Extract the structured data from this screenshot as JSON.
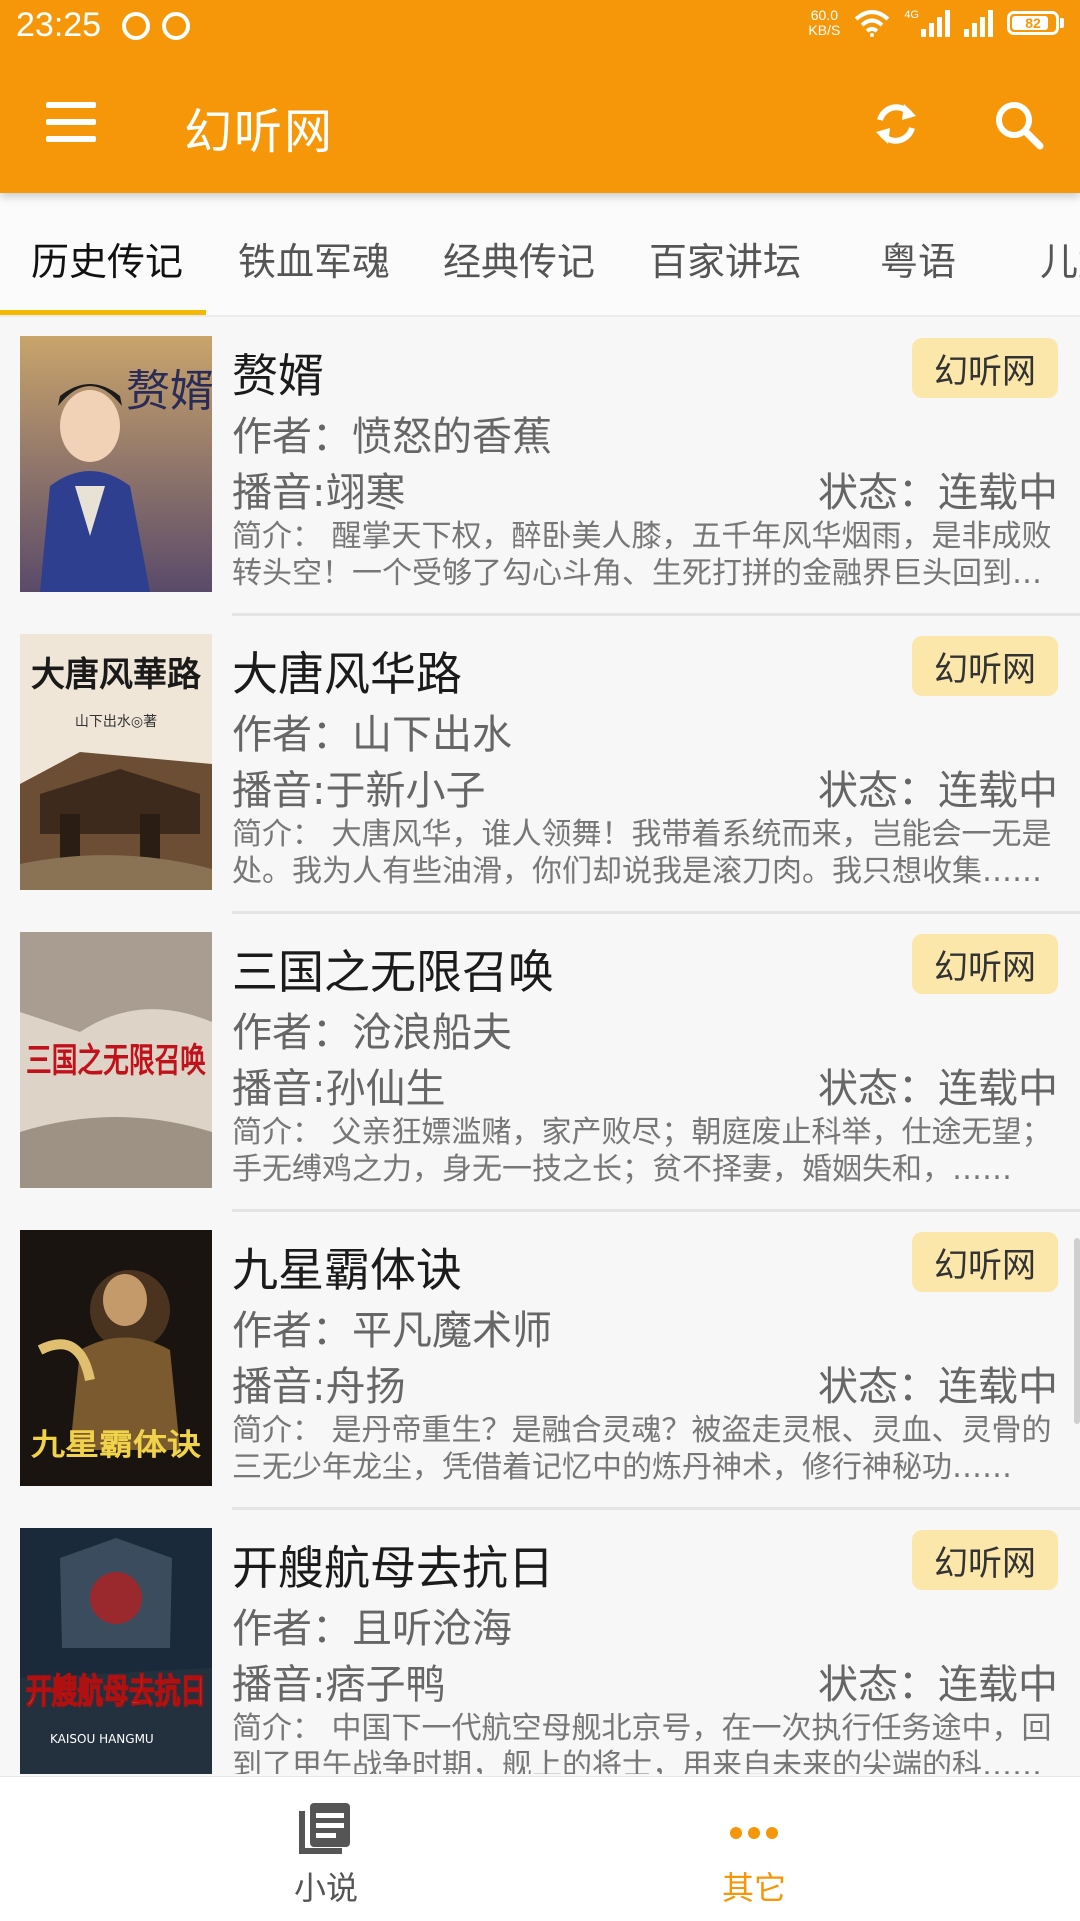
{
  "status_bar": {
    "time": "23:25",
    "net_speed_value": "60.0",
    "net_speed_unit": "KB/S",
    "network_type": "4G",
    "battery": "82"
  },
  "app_bar": {
    "title": "幻听网",
    "menu_icon": "hamburger-menu-icon",
    "refresh_icon": "refresh-icon",
    "search_icon": "search-icon",
    "color": "#f59709"
  },
  "tabs": [
    {
      "label": "历史传记",
      "active": true
    },
    {
      "label": "铁血军魂"
    },
    {
      "label": "经典传记"
    },
    {
      "label": "百家讲坛"
    },
    {
      "label": "粤语"
    },
    {
      "label": "儿童"
    }
  ],
  "books": [
    {
      "title": "赘婿",
      "source": "幻听网",
      "author": "作者：愤怒的香蕉",
      "narrator": "播音:翊寒",
      "status": "状态：连载中",
      "desc": "简介：  醒掌天下权，醉卧美人膝，五千年风华烟雨，是非成败转头空！一个受够了勾心斗角、生死打拼的金融界巨头回到了古代……",
      "cover_text": "赘婿"
    },
    {
      "title": "大唐风华路",
      "source": "幻听网",
      "author": "作者：山下出水",
      "narrator": "播音:于新小子",
      "status": "状态：连载中",
      "desc": "简介：  大唐风华，谁人领舞！我带着系统而来，岂能会一无是处。我为人有些油滑，你们却说我是滚刀肉。我只想收集……",
      "cover_text": "大唐风華路",
      "cover_subtext": "山下出水◎著"
    },
    {
      "title": "三国之无限召唤",
      "source": "幻听网",
      "author": "作者：沧浪船夫",
      "narrator": "播音:孙仙生",
      "status": "状态：连载中",
      "desc": "简介：  父亲狂嫖滥赌，家产败尽；朝庭废止科举，仕途无望；手无缚鸡之力，身无一技之长；贫不择妻，婚姻失和，……",
      "cover_text": "三国之无限召唤"
    },
    {
      "title": "九星霸体诀",
      "source": "幻听网",
      "author": "作者：平凡魔术师",
      "narrator": "播音:舟扬",
      "status": "状态：连载中",
      "desc": "简介：  是丹帝重生？是融合灵魂？被盗走灵根、灵血、灵骨的三无少年龙尘，凭借着记忆中的炼丹神术，修行神秘功……",
      "cover_text": "九星霸体诀"
    },
    {
      "title": "开艘航母去抗日",
      "source": "幻听网",
      "author": "作者：且听沧海",
      "narrator": "播音:痞子鸭",
      "status": "状态：连载中",
      "desc": "简介：  中国下一代航空母舰北京号，在一次执行任务途中，回到了甲午战争时期，舰上的将士，用来自未来的尖端的科……",
      "cover_text": "开艘航母去抗日",
      "cover_subtext": "KAISOU HANGMU"
    }
  ],
  "bottom_nav": [
    {
      "label": "小说",
      "icon": "book-list-icon",
      "active": false
    },
    {
      "label": "其它",
      "icon": "more-dots-icon",
      "active": true
    }
  ],
  "colors": {
    "primary": "#f59709",
    "tab_indicator": "#f5b800",
    "badge_bg": "#fce7aa",
    "active_nav": "#f59709",
    "inactive_nav": "#555555"
  }
}
